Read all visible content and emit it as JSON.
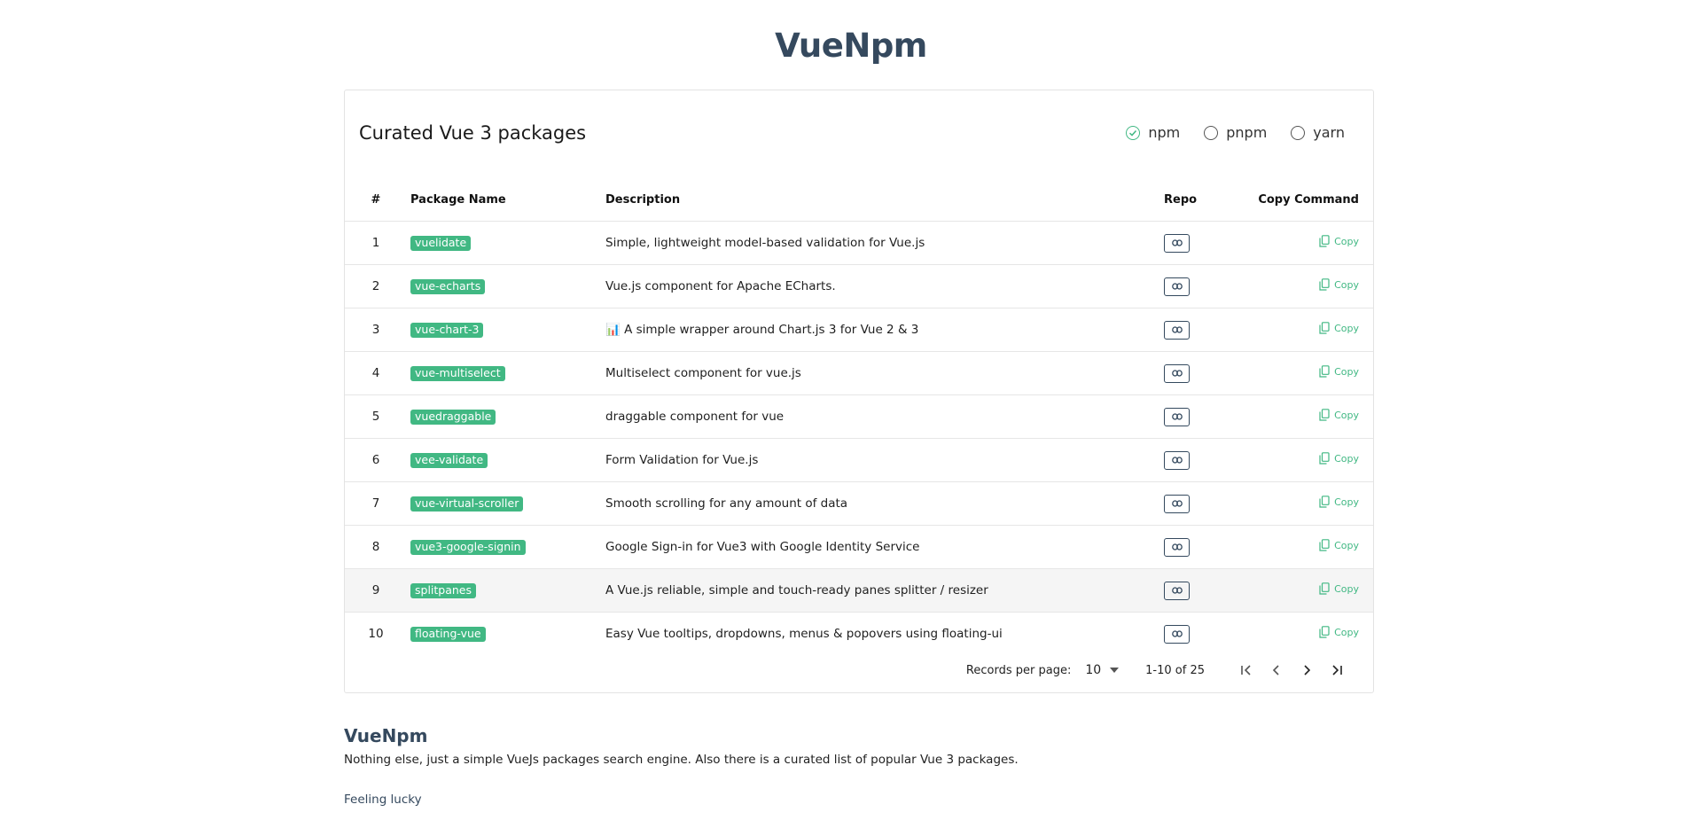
{
  "header": {
    "title": "VueNpm"
  },
  "card": {
    "title": "Curated Vue 3 packages",
    "package_managers": [
      {
        "label": "npm",
        "selected": true
      },
      {
        "label": "pnpm",
        "selected": false
      },
      {
        "label": "yarn",
        "selected": false
      }
    ]
  },
  "table": {
    "headers": {
      "num": "#",
      "name": "Package Name",
      "description": "Description",
      "repo": "Repo",
      "copy": "Copy Command"
    },
    "copy_label": "Copy",
    "rows": [
      {
        "num": "1",
        "name": "vuelidate",
        "description": "Simple, lightweight model-based validation for Vue.js"
      },
      {
        "num": "2",
        "name": "vue-echarts",
        "description": "Vue.js component for Apache ECharts."
      },
      {
        "num": "3",
        "name": "vue-chart-3",
        "description": "📊 A simple wrapper around Chart.js 3 for Vue 2 & 3"
      },
      {
        "num": "4",
        "name": "vue-multiselect",
        "description": "Multiselect component for vue.js"
      },
      {
        "num": "5",
        "name": "vuedraggable",
        "description": "draggable component for vue"
      },
      {
        "num": "6",
        "name": "vee-validate",
        "description": "Form Validation for Vue.js"
      },
      {
        "num": "7",
        "name": "vue-virtual-scroller",
        "description": "Smooth scrolling for any amount of data"
      },
      {
        "num": "8",
        "name": "vue3-google-signin",
        "description": "Google Sign-in for Vue3 with Google Identity Service"
      },
      {
        "num": "9",
        "name": "splitpanes",
        "description": "A Vue.js reliable, simple and touch-ready panes splitter / resizer"
      },
      {
        "num": "10",
        "name": "floating-vue",
        "description": "Easy Vue tooltips, dropdowns, menus & popovers using floating-ui"
      }
    ]
  },
  "pagination": {
    "records_per_page_label": "Records per page:",
    "records_per_page": "10",
    "range": "1-10 of 25"
  },
  "footer": {
    "title": "VueNpm",
    "text": "Nothing else, just a simple VueJs packages search engine. Also there is a curated list of popular Vue 3 packages.",
    "link": "Feeling lucky"
  },
  "colors": {
    "accent": "#41b883",
    "brand": "#35495e"
  }
}
